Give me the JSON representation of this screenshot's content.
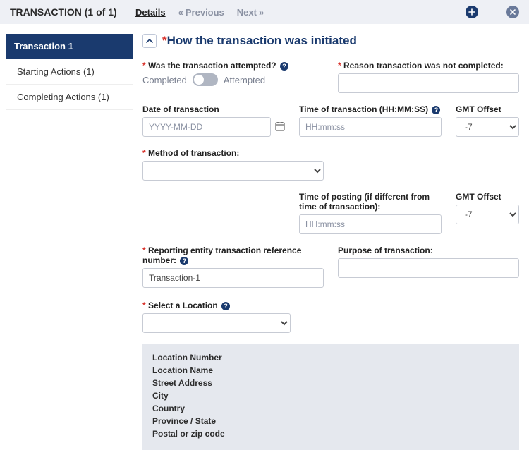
{
  "topbar": {
    "title": "TRANSACTION (1 of 1)",
    "details_tab": "Details",
    "prev": "Previous",
    "next": "Next"
  },
  "sidebar": {
    "items": [
      {
        "label": "Transaction 1"
      },
      {
        "label": "Starting Actions (1)"
      },
      {
        "label": "Completing Actions (1)"
      }
    ]
  },
  "section": {
    "title": "How the transaction was initiated"
  },
  "fields": {
    "attempted_label": "Was the transaction attempted?",
    "toggle_left": "Completed",
    "toggle_right": "Attempted",
    "reason_label": "Reason transaction was not completed:",
    "reason_value": "",
    "date_label": "Date of transaction",
    "date_placeholder": "YYYY-MM-DD",
    "time_tx_label": "Time of transaction (HH:MM:SS)",
    "time_placeholder": "HH:mm:ss",
    "gmt_label": "GMT Offset",
    "gmt_value": "-7",
    "method_label": "Method of transaction:",
    "time_posting_label": "Time of posting (if different from time of transaction):",
    "gmt2_value": "-7",
    "refno_label": "Reporting entity transaction reference number:",
    "refno_value": "Transaction-1",
    "purpose_label": "Purpose of transaction:",
    "purpose_value": "",
    "location_label": "Select a Location"
  },
  "location_box": [
    "Location Number",
    "Location Name",
    "Street Address",
    "City",
    "Country",
    "Province / State",
    "Postal or zip code"
  ]
}
